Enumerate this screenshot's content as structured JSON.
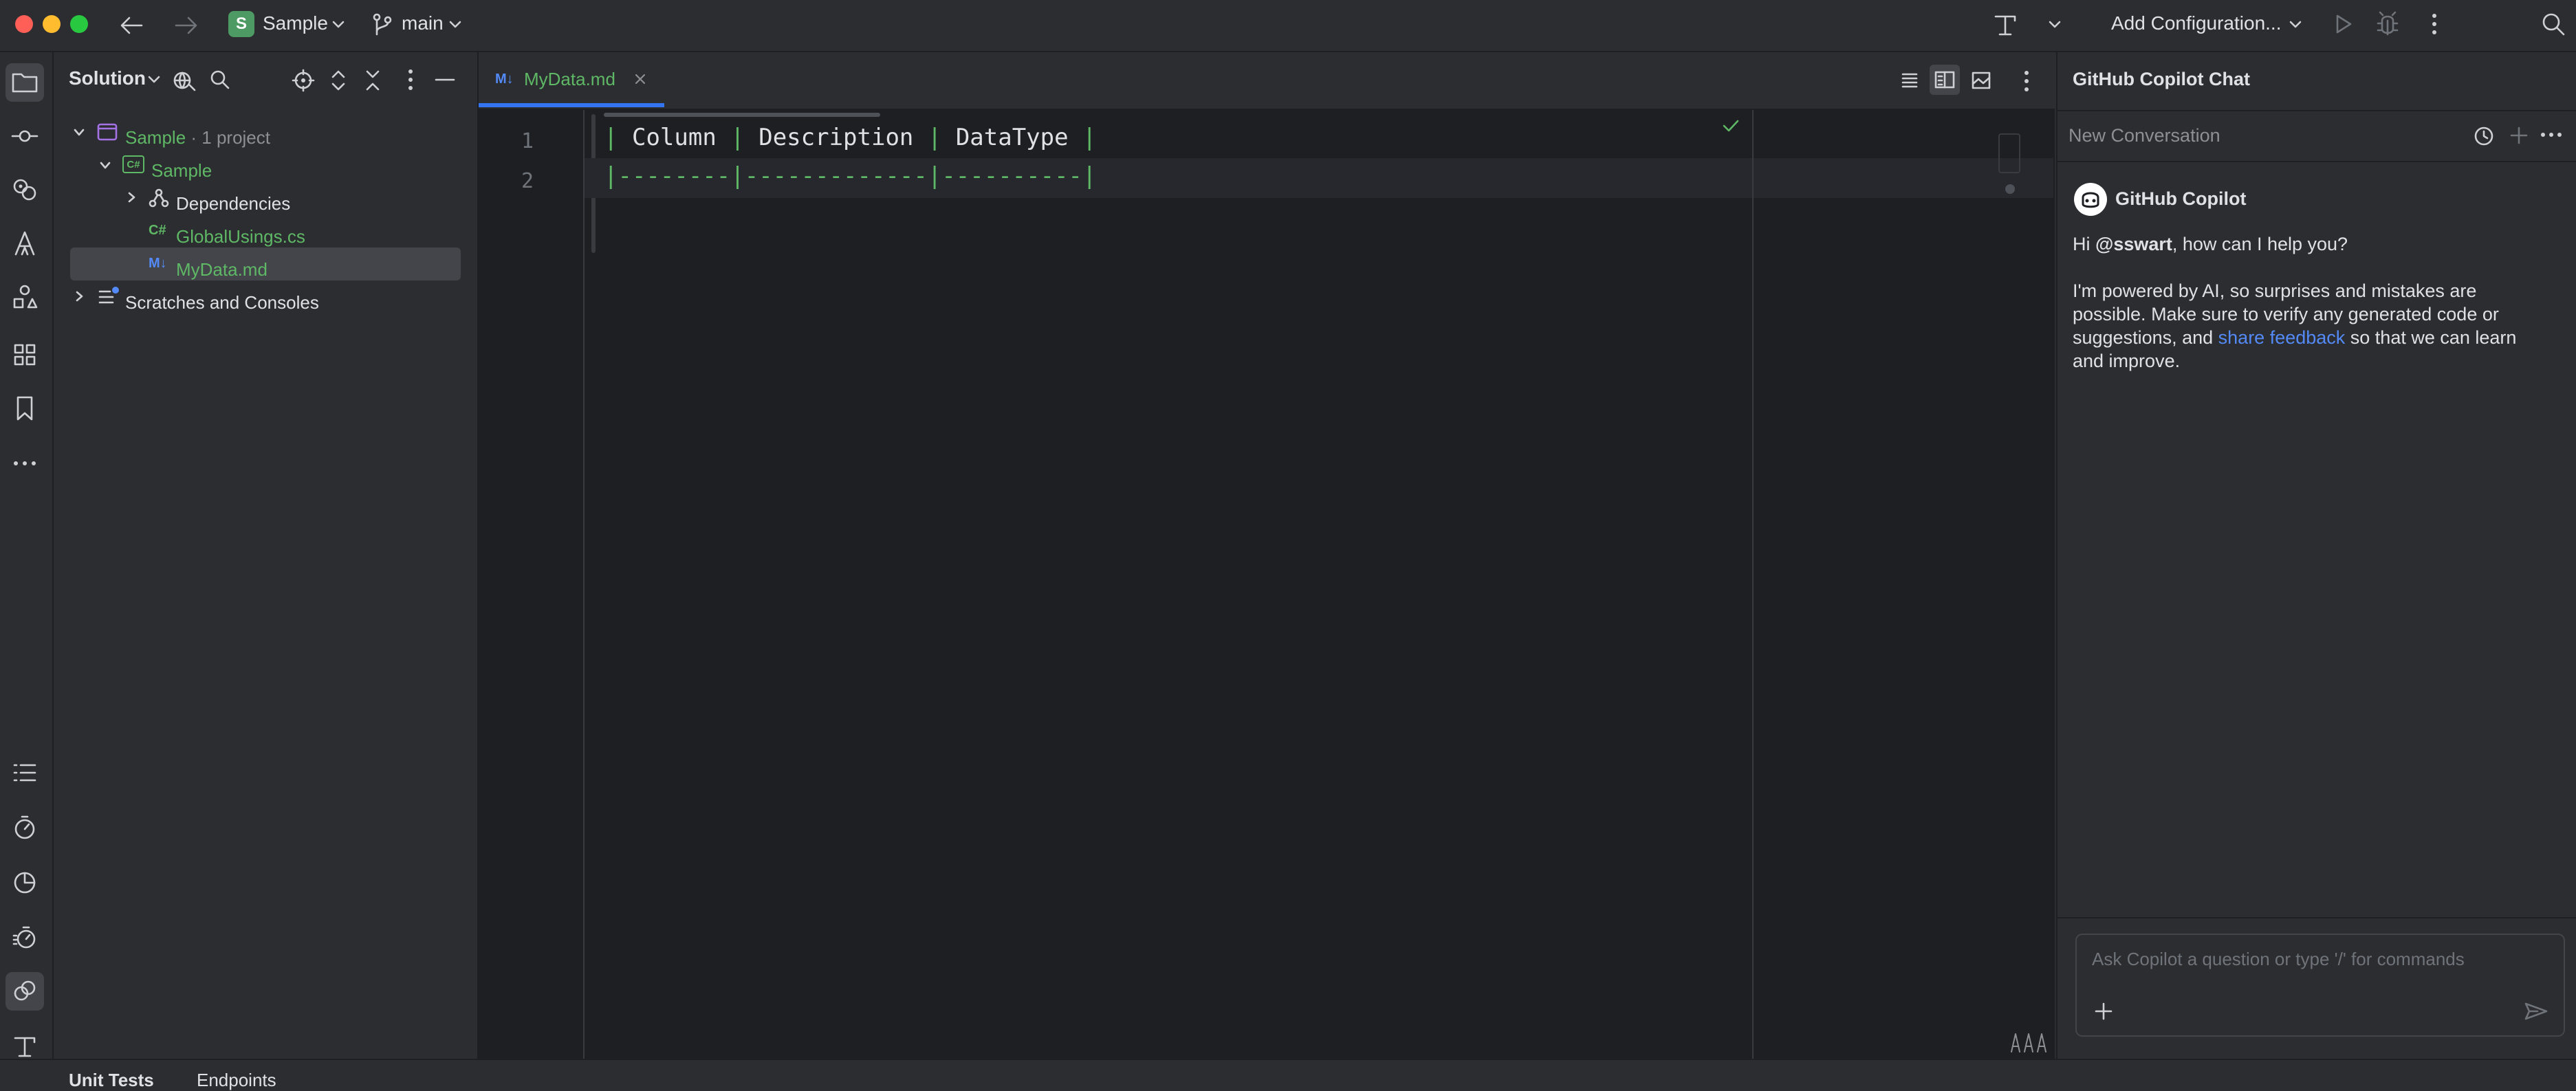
{
  "titlebar": {
    "project_badge": "S",
    "project_name": "Sample",
    "branch": "main",
    "run_config": "Add Configuration..."
  },
  "project_panel": {
    "title": "Solution",
    "tree": [
      {
        "label": "Sample",
        "suffix": " · 1 project",
        "icon": "solution-icon",
        "color": "green"
      },
      {
        "label": "Sample",
        "icon": "csharp-project-icon",
        "color": "green"
      },
      {
        "label": "Dependencies",
        "icon": "dependencies-icon",
        "color": "default"
      },
      {
        "label": "GlobalUsings.cs",
        "icon": "csharp-file-icon",
        "color": "green"
      },
      {
        "label": "MyData.md",
        "icon": "markdown-file-icon",
        "color": "green",
        "selected": true
      },
      {
        "label": "Scratches and Consoles",
        "icon": "scratches-icon",
        "color": "default"
      }
    ],
    "csharp_badge": "C#",
    "cs_file_badge": "C#",
    "md_badge": "M↓"
  },
  "editor": {
    "tab": {
      "label": "MyData.md",
      "badge": "M↓"
    },
    "lines": [
      {
        "number": "1",
        "cells": [
          "Column",
          "Description",
          "DataType"
        ]
      },
      {
        "number": "2",
        "separators": [
          "--------",
          "-------------",
          "----------"
        ]
      }
    ]
  },
  "copilot": {
    "panel_title": "GitHub Copilot Chat",
    "conversation_title": "New Conversation",
    "bot_name": "GitHub Copilot",
    "greeting_prefix": "Hi ",
    "greeting_user": "@sswart",
    "greeting_suffix": ", how can I help you?",
    "intro_1": "I'm powered by AI, so surprises and mistakes are",
    "intro_2": "possible. Make sure to verify any generated code or",
    "intro_3_prefix": "suggestions, and ",
    "intro_link": "share feedback",
    "intro_3_suffix": " so that we can learn",
    "intro_4": "and improve.",
    "input_placeholder": "Ask Copilot a question or type '/' for commands"
  },
  "bottom": {
    "tab1": "Unit Tests",
    "tab2": "Endpoints"
  },
  "colors": {
    "accent": "#548af7",
    "green": "#5fb865",
    "badge_green": "#4e9a64"
  }
}
